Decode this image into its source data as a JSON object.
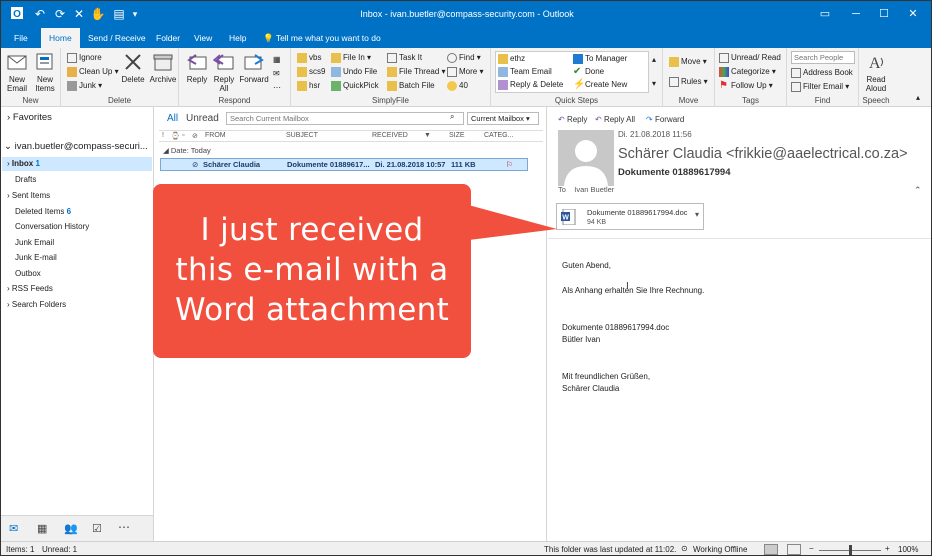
{
  "titlebar": {
    "title": "Inbox - ivan.buetler@compass-security.com  -  Outlook"
  },
  "menu_tabs": [
    "File",
    "Home",
    "Send / Receive",
    "Folder",
    "View",
    "Help"
  ],
  "tell_me": "Tell me what you want to do",
  "ribbon": {
    "new": {
      "new_email": "New\nEmail",
      "new_items": "New\nItems",
      "label": "New"
    },
    "delete": {
      "ignore": "Ignore",
      "clean_up": "Clean Up",
      "junk": "Junk",
      "delete": "Delete",
      "archive": "Archive",
      "label": "Delete"
    },
    "respond": {
      "reply": "Reply",
      "reply_all": "Reply\nAll",
      "forward": "Forward",
      "label": "Respond"
    },
    "simplyfile": {
      "vbs": "vbs",
      "scs9": "scs9",
      "hsr": "hsr",
      "file_in": "File In",
      "undo_file": "Undo File",
      "quickpick": "QuickPick",
      "task_it": "Task It",
      "file_thread": "File Thread",
      "batch_file": "Batch File",
      "find": "Find",
      "more": "More",
      "forty": "40",
      "label": "SimplyFile"
    },
    "quicksteps": {
      "ethz": "ethz",
      "team_email": "Team Email",
      "reply_delete": "Reply & Delete",
      "to_manager": "To Manager",
      "done": "Done",
      "create_new": "Create New",
      "label": "Quick Steps"
    },
    "move": {
      "move": "Move",
      "rules": "Rules",
      "label": "Move"
    },
    "tags": {
      "unread_read": "Unread/ Read",
      "categorize": "Categorize",
      "follow_up": "Follow Up",
      "label": "Tags"
    },
    "find": {
      "search_people": "Search People",
      "address_book": "Address Book",
      "filter_email": "Filter Email",
      "label": "Find"
    },
    "speech": {
      "read_aloud": "Read\nAloud",
      "label": "Speech"
    }
  },
  "nav": {
    "favorites": "Favorites",
    "account": "ivan.buetler@compass-securi...",
    "inbox": "Inbox",
    "inbox_count": "1",
    "drafts": "Drafts",
    "sent": "Sent Items",
    "deleted": "Deleted Items",
    "deleted_count": "6",
    "conversation": "Conversation History",
    "junk_email": "Junk Email",
    "junk_email2": "Junk E-mail",
    "outbox": "Outbox",
    "rss": "RSS Feeds",
    "search_folders": "Search Folders"
  },
  "list": {
    "filter_all": "All",
    "filter_unread": "Unread",
    "search_placeholder": "Search Current Mailbox",
    "scope": "Current Mailbox",
    "cols": {
      "from": "FROM",
      "subject": "SUBJECT",
      "received": "RECEIVED",
      "size": "SIZE",
      "categ": "CATEG..."
    },
    "group": "Date: Today",
    "row": {
      "from": "Schärer  Claudia",
      "subject": "Dokumente 01889617...",
      "received": "Di. 21.08.2018 10:57",
      "size": "111 KB"
    }
  },
  "reading": {
    "reply": "Reply",
    "reply_all": "Reply All",
    "forward": "Forward",
    "date": "Di. 21.08.2018 11:56",
    "sender": "Schärer  Claudia <frikkie@aaelectrical.co.za>",
    "subject": "Dokumente 01889617994",
    "to_label": "To",
    "to_value": "Ivan Buetler",
    "attachment_name": "Dokumente 01889617994.doc",
    "attachment_size": "94 KB",
    "body": [
      "Guten Abend,",
      "Als Anhang erhalten Sie Ihre Rechnung.",
      "Dokumente 01889617994.doc",
      "Bütler  Ivan",
      "Mit freundlichen Grüßen,",
      "Schärer  Claudia"
    ]
  },
  "callout": {
    "lines": [
      "I just received",
      "this e-mail with a",
      "Word attachment"
    ]
  },
  "status": {
    "items": "Items: 1",
    "unread": "Unread: 1",
    "updated": "This folder was last updated at 11:02.",
    "offline": "Working Offline",
    "zoom": "100%"
  },
  "colors": {
    "accent": "#0072c6",
    "callout": "#f1503e",
    "selection": "#cde8ff"
  }
}
